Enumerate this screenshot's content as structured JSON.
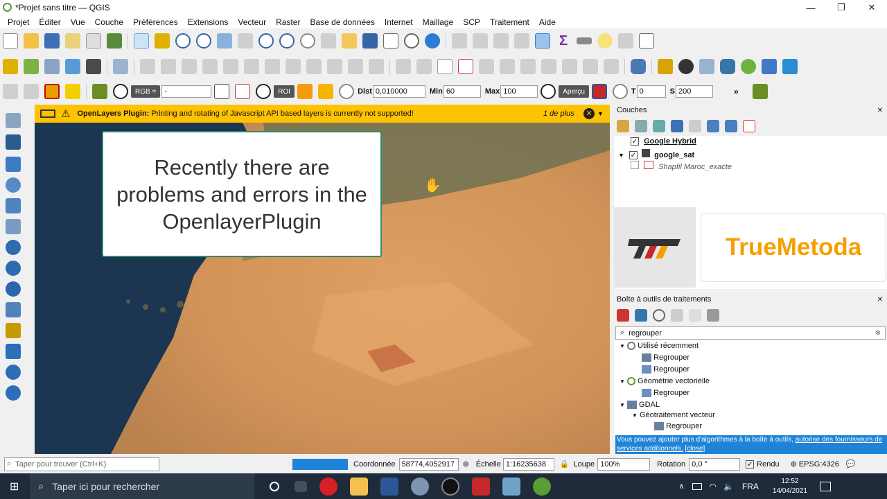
{
  "window": {
    "title": "*Projet sans titre — QGIS",
    "min": "—",
    "max": "❐",
    "close": "✕"
  },
  "menu": [
    "Projet",
    "Éditer",
    "Vue",
    "Couche",
    "Préférences",
    "Extensions",
    "Vecteur",
    "Raster",
    "Base de données",
    "Internet",
    "Maillage",
    "SCP",
    "Traitement",
    "Aide"
  ],
  "scp_toolbar": {
    "rgb_label": "RGB =",
    "rgb_value": "-",
    "roi_label": "ROI",
    "dist_label": "Dist",
    "dist_value": "0,010000",
    "min_label": "Min",
    "min_value": "60",
    "max_label": "Max",
    "max_value": "100",
    "apercu_label": "Aperçu",
    "t_label": "T",
    "t_value": "0",
    "s_label": "S",
    "s_value": "200"
  },
  "message": {
    "title": "OpenLayers Plugin:",
    "text": "Printing and rotating of Javascript API based layers is currently not supported!",
    "more": "1 de plus"
  },
  "overlay_note": "Recently there are problems and errors in the OpenlayerPlugin",
  "layers_panel": {
    "title": "Couches",
    "items": [
      {
        "name": "Google Hybrid",
        "checked": true
      },
      {
        "name": "google_sat",
        "checked": true
      },
      {
        "name": "Shapfil Maroc_exacte",
        "checked": false
      }
    ]
  },
  "brand": {
    "name": "TrueMetoda",
    "color": "#f5a000"
  },
  "toolbox": {
    "title": "Boîte à outils de traitements",
    "search_value": "regrouper",
    "groups": [
      {
        "label": "Utilisé récemment",
        "items": [
          "Regrouper",
          "Regrouper"
        ]
      },
      {
        "label": "Géométrie vectorielle",
        "items": [
          "Regrouper"
        ]
      },
      {
        "label": "GDAL",
        "sub": "Géotraitement vecteur",
        "items": [
          "Regrouper"
        ]
      }
    ],
    "info_text": "Vous pouvez ajouter plus d'algorithmes à la boîte à outils,",
    "info_link": "autorise des fournisseurs de services additionnels.",
    "info_close": "[close]"
  },
  "status": {
    "locator_placeholder": "Taper pour trouver (Ctrl+K)",
    "coord_label": "Coordonnée",
    "coord_value": "58774,4052917",
    "scale_label": "Échelle",
    "scale_value": "1:16235638",
    "loupe_label": "Loupe",
    "loupe_value": "100%",
    "rotation_label": "Rotation",
    "rotation_value": "0,0 °",
    "render_label": "Rendu",
    "epsg": "EPSG:4326"
  },
  "taskbar": {
    "search_placeholder": "Taper ici pour rechercher",
    "lang": "FRA",
    "time": "12:52",
    "date": "14/04/2021"
  }
}
